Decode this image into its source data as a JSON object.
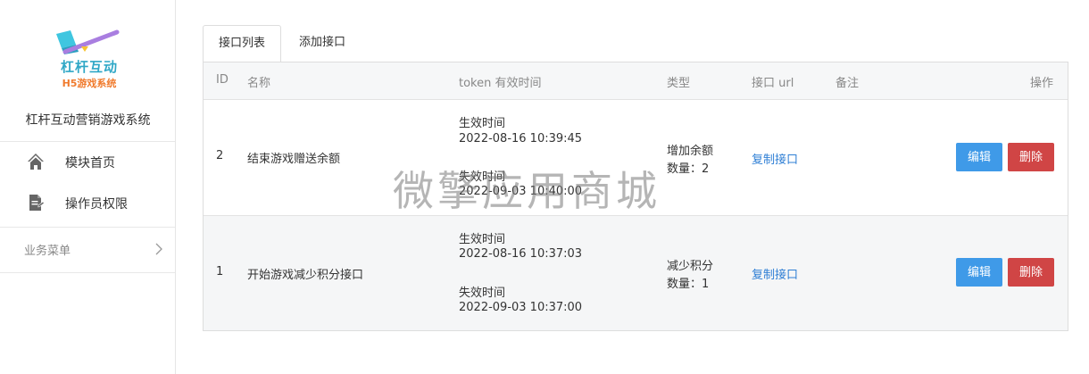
{
  "logo": {
    "title": "杠杆互动",
    "subtitle": "H5游戏系统"
  },
  "sidebar": {
    "system_name": "杠杆互动营销游戏系统",
    "items": [
      {
        "label": "模块首页",
        "icon": "home-icon"
      },
      {
        "label": "操作员权限",
        "icon": "document-icon"
      }
    ],
    "business_menu": {
      "label": "业务菜单",
      "icon": "chevron-right-icon"
    }
  },
  "tabs": [
    {
      "label": "接口列表",
      "active": true
    },
    {
      "label": "添加接口",
      "active": false
    }
  ],
  "table": {
    "headers": {
      "id": "ID",
      "name": "名称",
      "token_time": "token 有效时间",
      "type": "类型",
      "url": "接口 url",
      "remark": "备注",
      "actions": "操作"
    },
    "rows": [
      {
        "id": "2",
        "name": "结束游戏赠送余额",
        "start_label": "生效时间",
        "start_time": "2022-08-16 10:39:45",
        "end_label": "失效时间",
        "end_time": "2022-09-03 10:40:00",
        "type_name": "增加余额",
        "type_qty": "数量：2",
        "url_link": "复制接口",
        "remark": "",
        "edit": "编辑",
        "delete": "删除"
      },
      {
        "id": "1",
        "name": "开始游戏减少积分接口",
        "start_label": "生效时间",
        "start_time": "2022-08-16 10:37:03",
        "end_label": "失效时间",
        "end_time": "2022-09-03 10:37:00",
        "type_name": "减少积分",
        "type_qty": "数量：1",
        "url_link": "复制接口",
        "remark": "",
        "edit": "编辑",
        "delete": "删除"
      }
    ]
  },
  "watermark": "微擎应用商城",
  "colors": {
    "edit_button": "#3f9ae8",
    "delete_button": "#d04545",
    "link": "#2f7fd5"
  }
}
